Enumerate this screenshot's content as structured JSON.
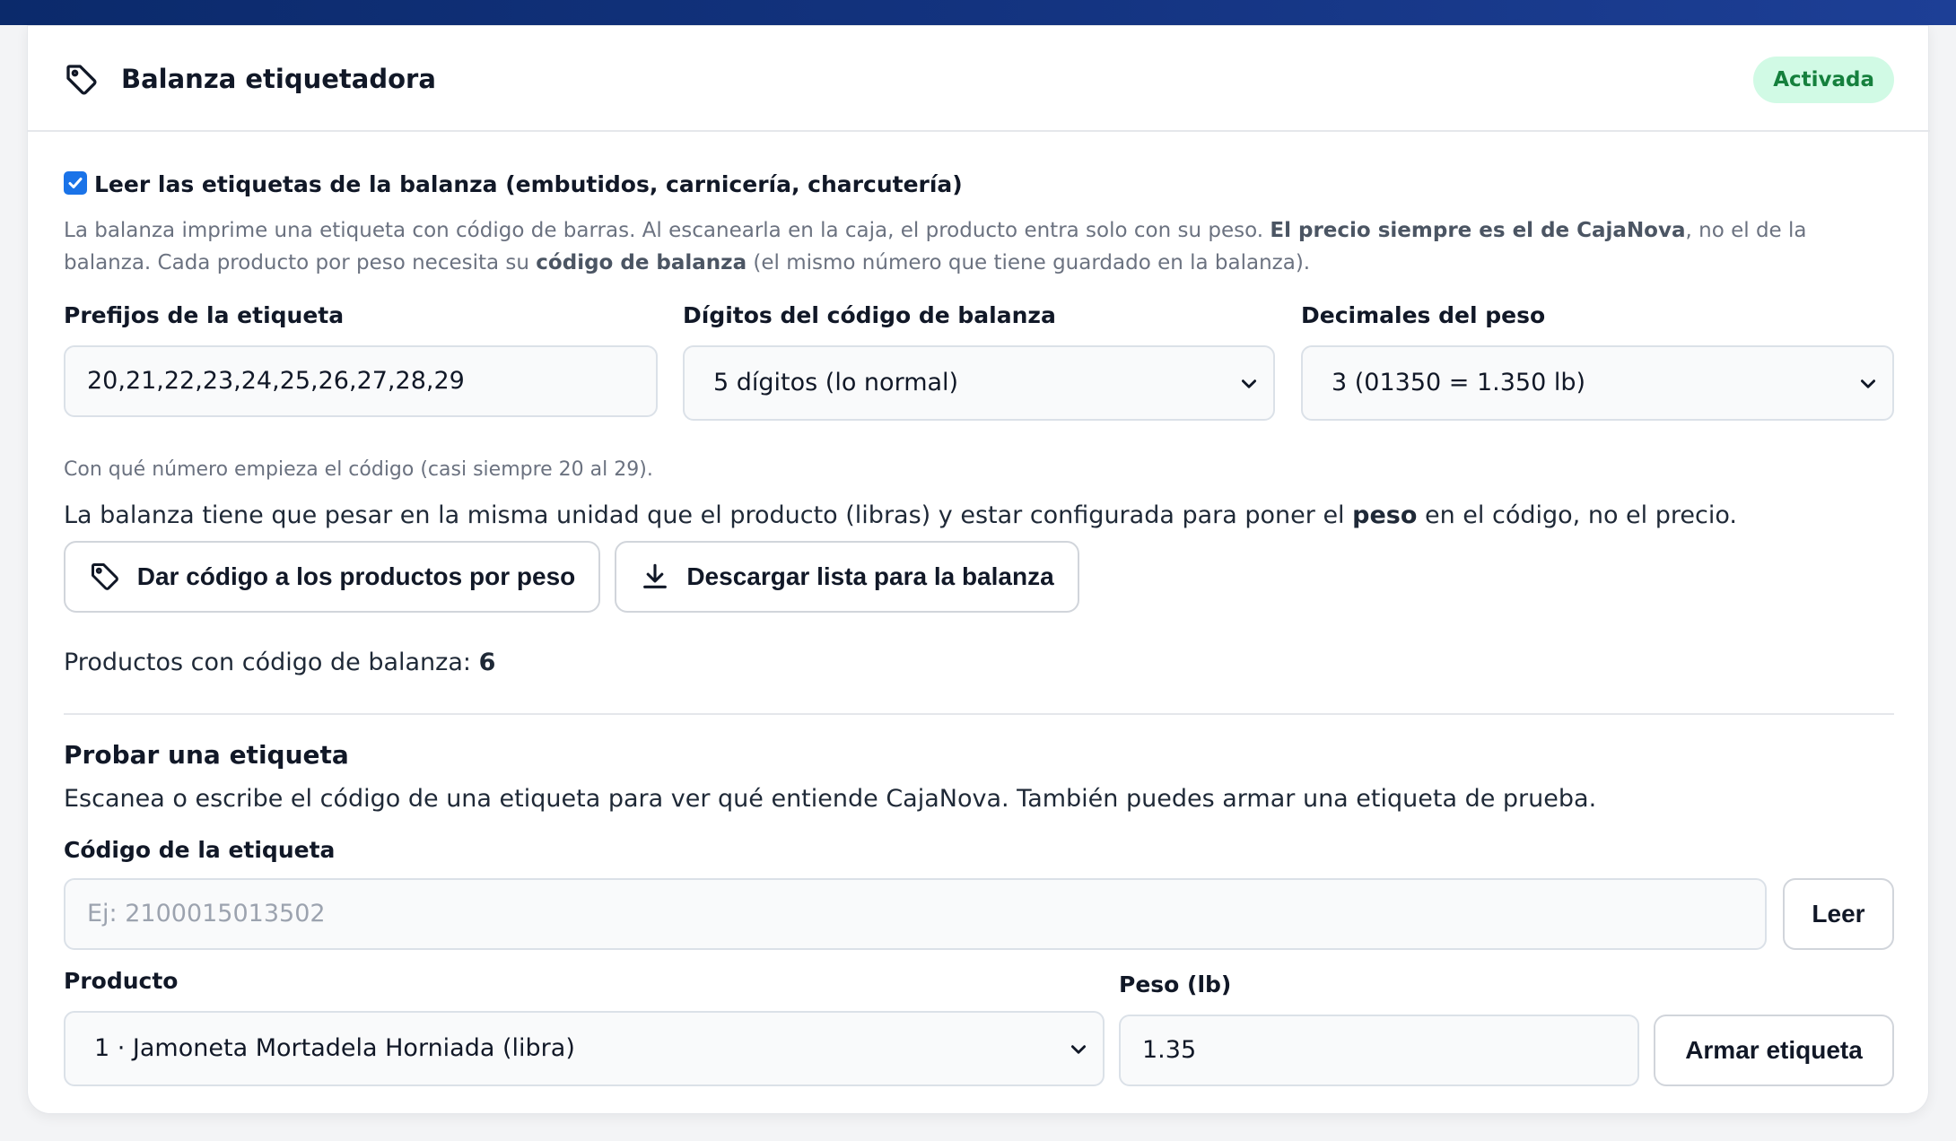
{
  "header": {
    "title": "Balanza etiquetadora",
    "status_badge": "Activada",
    "icon": "tag-icon"
  },
  "read_labels": {
    "checked": true,
    "label": "Leer las etiquetas de la balanza (embutidos, carnicería, charcutería)"
  },
  "description": {
    "part1": "La balanza imprime una etiqueta con código de barras. Al escanearla en la caja, el producto entra solo con su peso. ",
    "bold1": "El precio siempre es el de CajaNova",
    "part2": ", no el de la balanza. Cada producto por peso necesita su ",
    "bold2": "código de balanza",
    "part3": " (el mismo número que tiene guardado en la balanza)."
  },
  "settings": {
    "prefixes": {
      "label": "Prefijos de la etiqueta",
      "value": "20,21,22,23,24,25,26,27,28,29",
      "hint": "Con qué número empieza el código (casi siempre 20 al 29)."
    },
    "digits": {
      "label": "Dígitos del código de balanza",
      "selected": "5 dígitos (lo normal)"
    },
    "decimals": {
      "label": "Decimales del peso",
      "selected": "3 (01350 = 1.350 lb)"
    }
  },
  "unit_note": {
    "part1": "La balanza tiene que pesar en la misma unidad que el producto (libras) y estar configurada para poner el ",
    "bold": "peso",
    "part2": " en el código, no el precio."
  },
  "actions": {
    "assign_codes": "Dar código a los productos por peso",
    "download_list": "Descargar lista para la balanza"
  },
  "products_count": {
    "label": "Productos con código de balanza: ",
    "value": "6"
  },
  "test_section": {
    "title": "Probar una etiqueta",
    "description": "Escanea o escribe el código de una etiqueta para ver qué entiende CajaNova. También puedes armar una etiqueta de prueba.",
    "code_label": "Código de la etiqueta",
    "code_placeholder": "Ej: 2100015013502",
    "read_button": "Leer",
    "product_label": "Producto",
    "product_selected": "1 · Jamoneta Mortadela Horniada (libra)",
    "weight_label": "Peso (lb)",
    "weight_value": "1.35",
    "build_button": "Armar etiqueta"
  },
  "colors": {
    "accent": "#1a73e8",
    "badge_bg": "#d1fae5",
    "badge_text": "#15803d",
    "topbar": "#13337f"
  }
}
